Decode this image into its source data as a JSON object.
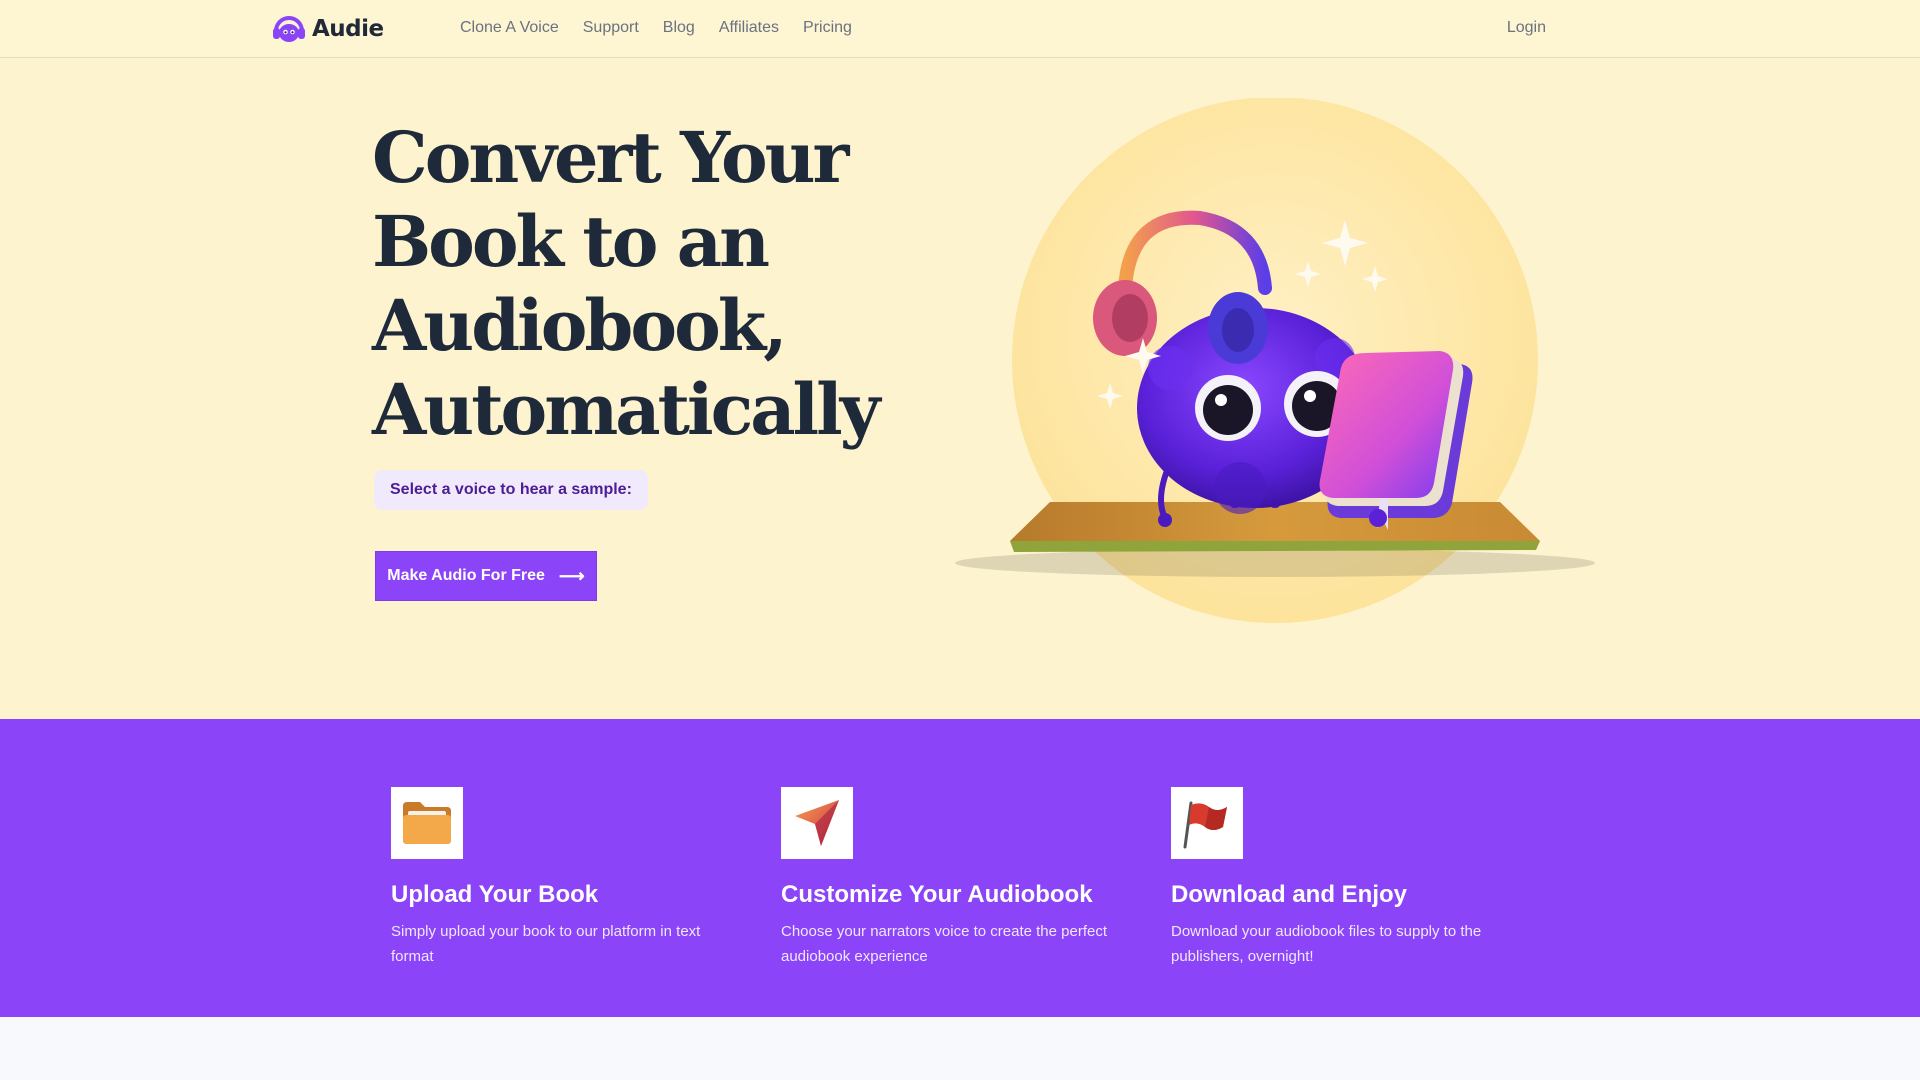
{
  "nav": {
    "logo_text": "Audie",
    "logo_icon": "headphone-mascot-icon",
    "links": [
      "Clone A Voice",
      "Support",
      "Blog",
      "Affiliates",
      "Pricing"
    ],
    "login": "Login"
  },
  "hero": {
    "title_lines": [
      "Convert Your",
      "Book to an",
      "Audiobook,",
      "Automatically"
    ],
    "voice_prompt": "Select a voice to hear a sample:",
    "cta_label": "Make Audio For Free",
    "cta_icon": "arrow-right-icon",
    "illustration": "purple-fuzzy-mascot-with-headphones-and-book"
  },
  "steps": [
    {
      "icon": "folder-icon",
      "title": "Upload Your Book",
      "desc": "Simply upload your book to our platform in text format"
    },
    {
      "icon": "paper-plane-icon",
      "title": "Customize Your Audiobook",
      "desc": "Choose your narrators voice to create the perfect audiobook experience"
    },
    {
      "icon": "flag-icon",
      "title": "Download and Enjoy",
      "desc": "Download your audiobook files to supply to the publishers, overnight!"
    }
  ],
  "colors": {
    "background": "#fdf3cf",
    "accent": "#8b44f7",
    "heading": "#1e2a3a",
    "muted": "#6b7280"
  }
}
